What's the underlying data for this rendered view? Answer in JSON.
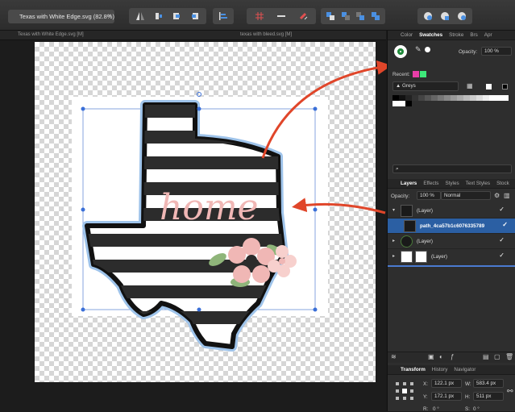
{
  "doc_tab": {
    "title": "Texas with White Edge.svg (82.8%)",
    "close": "×"
  },
  "subbar": {
    "left": "Texas with White Edge.svg [M]",
    "right": "texas with bleed.svg [M]"
  },
  "panel": {
    "color_tabs": [
      "Color",
      "Swatches",
      "Stroke",
      "Brs",
      "Apr"
    ],
    "active_color_tab": "Swatches",
    "opacity_label": "Opacity:",
    "opacity_value": "100 %",
    "recent_label": "Recent:",
    "recent_colors": [
      "#e83ea8",
      "#3ee87a"
    ],
    "palette_name": "Greys",
    "search_placeholder": "",
    "layer_tabs": [
      "Layers",
      "Effects",
      "Styles",
      "Text Styles",
      "Stock"
    ],
    "active_layer_tab": "Layers",
    "layers_opacity_label": "Opacity:",
    "layers_opacity_value": "100 %",
    "blend_mode": "Normal",
    "layers": [
      {
        "name": "(Layer)",
        "selected": false,
        "checked": "✓"
      },
      {
        "name": "path_4ca57b1c6076335789",
        "selected": true,
        "checked": "✓"
      },
      {
        "name": "(Layer)",
        "selected": false,
        "checked": "✓"
      },
      {
        "name": "(Layer)",
        "selected": false,
        "checked": "✓"
      }
    ],
    "transform_tabs": [
      "Transform",
      "History",
      "Navigator"
    ],
    "transform": {
      "x_label": "X:",
      "x": "122.1 px",
      "y_label": "Y:",
      "y": "172.1 px",
      "w_label": "W:",
      "w": "583.4 px",
      "h_label": "H:",
      "h": "511 px",
      "r_label": "R:",
      "r": "0 °",
      "s_label": "S:",
      "s": "0 °"
    }
  },
  "design": {
    "word": "home"
  },
  "colors": {
    "accent": "#2b5fa3",
    "annotation_arrow": "#e0462a",
    "pink": "#f0b7b5"
  }
}
